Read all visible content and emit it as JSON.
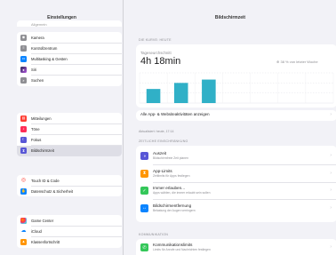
{
  "status_bar": {
    "time": "17:14  Mittwoch 13. Feb.",
    "battery": "✆ 66 %"
  },
  "sidebar": {
    "title": "Einstellungen",
    "partial_item": "Allgemein",
    "groups": [
      [
        {
          "label": "Kamera",
          "icon": "camera-icon",
          "color": "#8e8e93"
        },
        {
          "label": "Kontrollzentrum",
          "icon": "control-center-icon",
          "color": "#8e8e93"
        },
        {
          "label": "Multitasking & Gesten",
          "icon": "multitasking-icon",
          "color": "#0a84ff"
        },
        {
          "label": "Siri",
          "icon": "siri-icon",
          "color": "#2c2c54"
        },
        {
          "label": "Suchen",
          "icon": "search-icon",
          "color": "#8e8e93"
        }
      ],
      [
        {
          "label": "Mitteilungen",
          "icon": "notifications-icon",
          "color": "#ff3b30"
        },
        {
          "label": "Töne",
          "icon": "sounds-icon",
          "color": "#ff2d55"
        },
        {
          "label": "Fokus",
          "icon": "focus-icon",
          "color": "#5856d6"
        },
        {
          "label": "Bildschirmzeit",
          "icon": "hourglass-icon",
          "color": "#5856d6",
          "selected": true
        }
      ],
      [
        {
          "label": "Touch ID & Code",
          "icon": "fingerprint-icon",
          "color": "#ff3b30"
        },
        {
          "label": "Datenschutz & Sicherheit",
          "icon": "privacy-hand-icon",
          "color": "#0a84ff"
        }
      ],
      [
        {
          "label": "Game Center",
          "icon": "game-center-icon",
          "color": "#ffffff"
        },
        {
          "label": "iCloud",
          "icon": "icloud-icon",
          "color": "#ffffff"
        },
        {
          "label": "Klassenfortschritt",
          "icon": "class-progress-icon",
          "color": "#ff9500"
        }
      ]
    ]
  },
  "main": {
    "title": "Bildschirmzeit",
    "section_this_week": "DIE KURVE: HEUTE",
    "avg_label": "Tageseurchschnitt",
    "avg_value": "4h 18min",
    "compare_text": "⊕ 38 % von letzter Woche",
    "show_all": "Alle App- & Websiteaktivitäten anzeigen",
    "updated": "Aktualisiert: heute, 17:14",
    "section_limits": "ZEITLICHE EINSCHRÄNKUNG",
    "limits": [
      {
        "title": "Auszeit",
        "subtitle": "Bildschirmfreie Zeit planen",
        "icon": "downtime-icon",
        "color": "#5856d6"
      },
      {
        "title": "App-Limits",
        "subtitle": "Zeitlimits für Apps festlegen",
        "icon": "app-limits-icon",
        "color": "#ff9500"
      },
      {
        "title": "Immer erlauben...",
        "subtitle": "Apps wählen, die immer erlaubt sein sollen",
        "icon": "always-allowed-icon",
        "color": "#34c759"
      },
      {
        "title": "Bildschirmentfernung",
        "subtitle": "Belastung der Augen verringern",
        "icon": "screen-distance-icon",
        "color": "#0a84ff"
      }
    ],
    "section_communication": "KOMMUNIKATION",
    "communication": [
      {
        "title": "Kommunikationslimits",
        "subtitle": "Limits für Anrufe und Nachrichten festlegen",
        "icon": "communication-limits-icon",
        "color": "#34c759"
      }
    ]
  },
  "chart_data": {
    "type": "bar",
    "categories": [
      "Mo",
      "Di",
      "Mi",
      "Do",
      "Fr",
      "Sa",
      "So"
    ],
    "values": [
      2.1,
      3.0,
      3.5,
      0,
      0,
      0,
      0
    ],
    "bar_color": "#30b0c7",
    "ylim": [
      0,
      4.5
    ]
  }
}
